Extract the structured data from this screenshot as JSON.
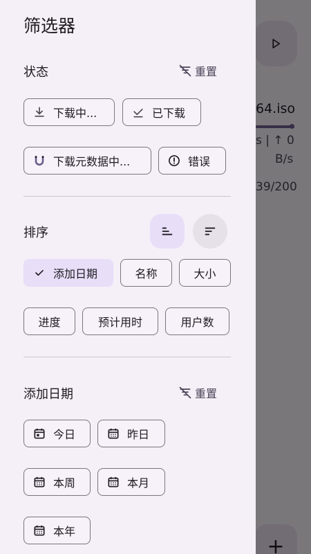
{
  "background": {
    "filename": "64.iso",
    "speed": "s | ↑ 0",
    "unit": "B/s",
    "count": "39/200",
    "progress": 0.95,
    "fab_label": "+"
  },
  "drawer": {
    "title": "筛选器",
    "status": {
      "heading": "状态",
      "reset": "重置",
      "chips": [
        "下载中...",
        "已下载",
        "下载元数据中...",
        "错误"
      ]
    },
    "sort": {
      "heading": "排序",
      "chips": [
        "添加日期",
        "名称",
        "大小",
        "进度",
        "预计用时",
        "用户数"
      ]
    },
    "date": {
      "heading": "添加日期",
      "reset": "重置",
      "chips": [
        "今日",
        "昨日",
        "本周",
        "本月",
        "本年"
      ]
    }
  },
  "colors": {
    "accent": "#e8def8",
    "outline": "#79747e",
    "surface": "#f5eff7"
  }
}
